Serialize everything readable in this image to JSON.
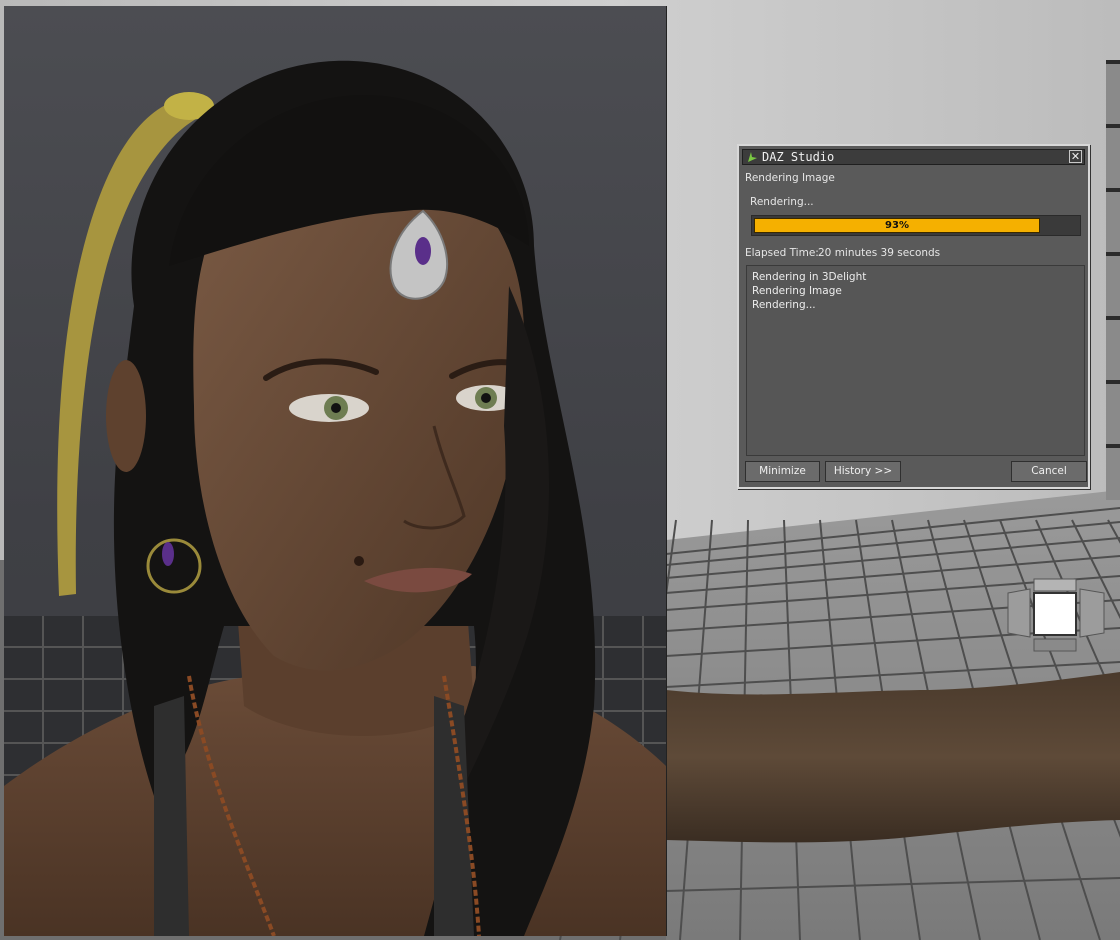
{
  "dialog": {
    "title": "DAZ Studio",
    "close_glyph": "✕",
    "heading": "Rendering Image",
    "status": "Rendering...",
    "progress_fraction": 0.93,
    "progress_label": "93%",
    "elapsed_label": "Elapsed Time:",
    "elapsed_value": "20 minutes 39 seconds",
    "log_lines": [
      "Rendering in 3Delight",
      "Rendering Image",
      "Rendering..."
    ],
    "buttons": {
      "minimize": "Minimize",
      "history": "History >>",
      "cancel": "Cancel"
    },
    "icon": "daz-logo-icon",
    "colors": {
      "progress_fill": "#f5b000",
      "dialog_bg": "#5a5a5a",
      "titlebar_bg": "#3c3c3c"
    }
  },
  "viewport": {
    "render_window_icon": "rendered-image",
    "light_icon": "light-gizmo-icon"
  }
}
